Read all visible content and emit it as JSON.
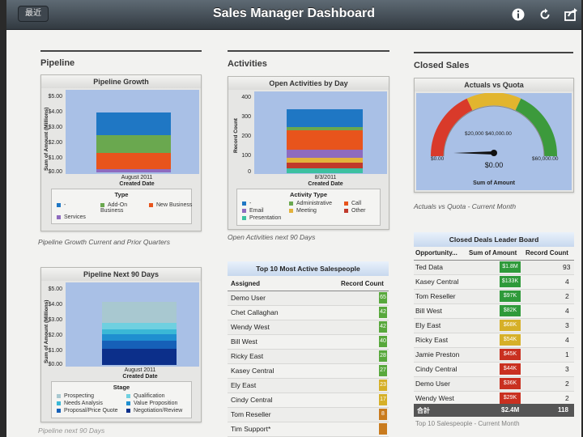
{
  "header": {
    "back_label": "最近",
    "title": "Sales Manager Dashboard"
  },
  "sections": {
    "pipeline": "Pipeline",
    "activities": "Activities",
    "closed_sales": "Closed Sales"
  },
  "pipeline_growth": {
    "title": "Pipeline Growth",
    "ylabel": "Sum of Amount (Millions)",
    "yticks": [
      "$5.00",
      "$4.00",
      "$3.00",
      "$2.00",
      "$1.00",
      "$0.00"
    ],
    "xtick": "August 2011",
    "xlabel": "Created Date",
    "legend_title": "Type",
    "legend": [
      {
        "label": "-",
        "color": "#1f77c4"
      },
      {
        "label": "Add-On Business",
        "color": "#6aa84f"
      },
      {
        "label": "New Business",
        "color": "#e8541c"
      },
      {
        "label": "Services",
        "color": "#8e6bbf"
      }
    ],
    "caption": "Pipeline Growth Current and Prior Quarters"
  },
  "pipeline_next90": {
    "title": "Pipeline Next 90 Days",
    "ylabel": "Sum of Amount (Millions)",
    "yticks": [
      "$5.00",
      "$4.00",
      "$3.00",
      "$2.00",
      "$1.00",
      "$0.00"
    ],
    "xtick": "August 2011",
    "xlabel": "Created Date",
    "legend_title": "Stage",
    "legend": [
      {
        "label": "Prospecting",
        "color": "#a8c8d0"
      },
      {
        "label": "Qualification",
        "color": "#6fd0e0"
      },
      {
        "label": "Needs Analysis",
        "color": "#3ab8d6"
      },
      {
        "label": "Value Proposition",
        "color": "#1f8fd0"
      },
      {
        "label": "Proposal/Price Quote",
        "color": "#1660b8"
      },
      {
        "label": "Negotiation/Review",
        "color": "#0c2f8a"
      }
    ],
    "caption": "Pipeline next 90 Days"
  },
  "open_activities": {
    "title": "Open Activities by Day",
    "ylabel": "Record Count",
    "yticks": [
      "400",
      "300",
      "200",
      "100",
      "0"
    ],
    "xtick": "8/3/2011",
    "xlabel": "Created Date",
    "legend_title": "Activity Type",
    "legend": [
      {
        "label": "-",
        "color": "#1f77c4"
      },
      {
        "label": "Administrative",
        "color": "#6aa84f"
      },
      {
        "label": "Call",
        "color": "#e8541c"
      },
      {
        "label": "Email",
        "color": "#8e6bbf"
      },
      {
        "label": "Meeting",
        "color": "#e3b23c"
      },
      {
        "label": "Other",
        "color": "#c0392b"
      },
      {
        "label": "Presentation",
        "color": "#3cc0a0"
      }
    ],
    "caption": "Open Activities next 90 Days"
  },
  "gauge": {
    "title": "Actuals vs Quota",
    "min_label": "$0.00",
    "max_label": "$60,000.00",
    "mid_labels": "$20,000 $40,000.00",
    "value_label": "$0.00",
    "xlabel": "Sum of Amount",
    "caption": "Actuals vs Quota - Current Month"
  },
  "top_salespeople": {
    "title": "Top 10 Most Active Salespeople",
    "col_assigned": "Assigned",
    "col_count": "Record Count",
    "rows": [
      {
        "name": "Demo User",
        "count": "65",
        "color": "#58a83c"
      },
      {
        "name": "Chet Callaghan",
        "count": "42",
        "color": "#58a83c"
      },
      {
        "name": "Wendy West",
        "count": "42",
        "color": "#58a83c"
      },
      {
        "name": "Bill West",
        "count": "40",
        "color": "#58a83c"
      },
      {
        "name": "Ricky East",
        "count": "28",
        "color": "#58a83c"
      },
      {
        "name": "Kasey Central",
        "count": "27",
        "color": "#58a83c"
      },
      {
        "name": "Ely East",
        "count": "23",
        "color": "#d6b028"
      },
      {
        "name": "Cindy Central",
        "count": "17",
        "color": "#d6b028"
      },
      {
        "name": "Tom Reseller",
        "count": "8",
        "color": "#c97b1e"
      },
      {
        "name": "Tim Support*",
        "count": "",
        "color": "#c97b1e"
      }
    ]
  },
  "leader_board": {
    "title": "Closed Deals Leader Board",
    "col_opportunity": "Opportunity...",
    "col_amount": "Sum of Amount",
    "col_count": "Record Count",
    "rows": [
      {
        "name": "Ted Data",
        "amount": "$1.8M",
        "count": "93",
        "color": "#2f9a3a"
      },
      {
        "name": "Kasey Central",
        "amount": "$133K",
        "count": "4",
        "color": "#2f9a3a"
      },
      {
        "name": "Tom Reseller",
        "amount": "$97K",
        "count": "2",
        "color": "#2f9a3a"
      },
      {
        "name": "Bill West",
        "amount": "$82K",
        "count": "4",
        "color": "#2f9a3a"
      },
      {
        "name": "Ely East",
        "amount": "$68K",
        "count": "3",
        "color": "#d6b028"
      },
      {
        "name": "Ricky East",
        "amount": "$54K",
        "count": "4",
        "color": "#d6b028"
      },
      {
        "name": "Jamie Preston",
        "amount": "$45K",
        "count": "1",
        "color": "#c93020"
      },
      {
        "name": "Cindy Central",
        "amount": "$44K",
        "count": "3",
        "color": "#c93020"
      },
      {
        "name": "Demo User",
        "amount": "$36K",
        "count": "2",
        "color": "#c93020"
      },
      {
        "name": "Wendy West",
        "amount": "$29K",
        "count": "2",
        "color": "#c93020"
      }
    ],
    "total_label": "合計",
    "total_amount": "$2.4M",
    "total_count": "118",
    "footer_partial": "Top 10 Salespeople - Current Month"
  }
}
